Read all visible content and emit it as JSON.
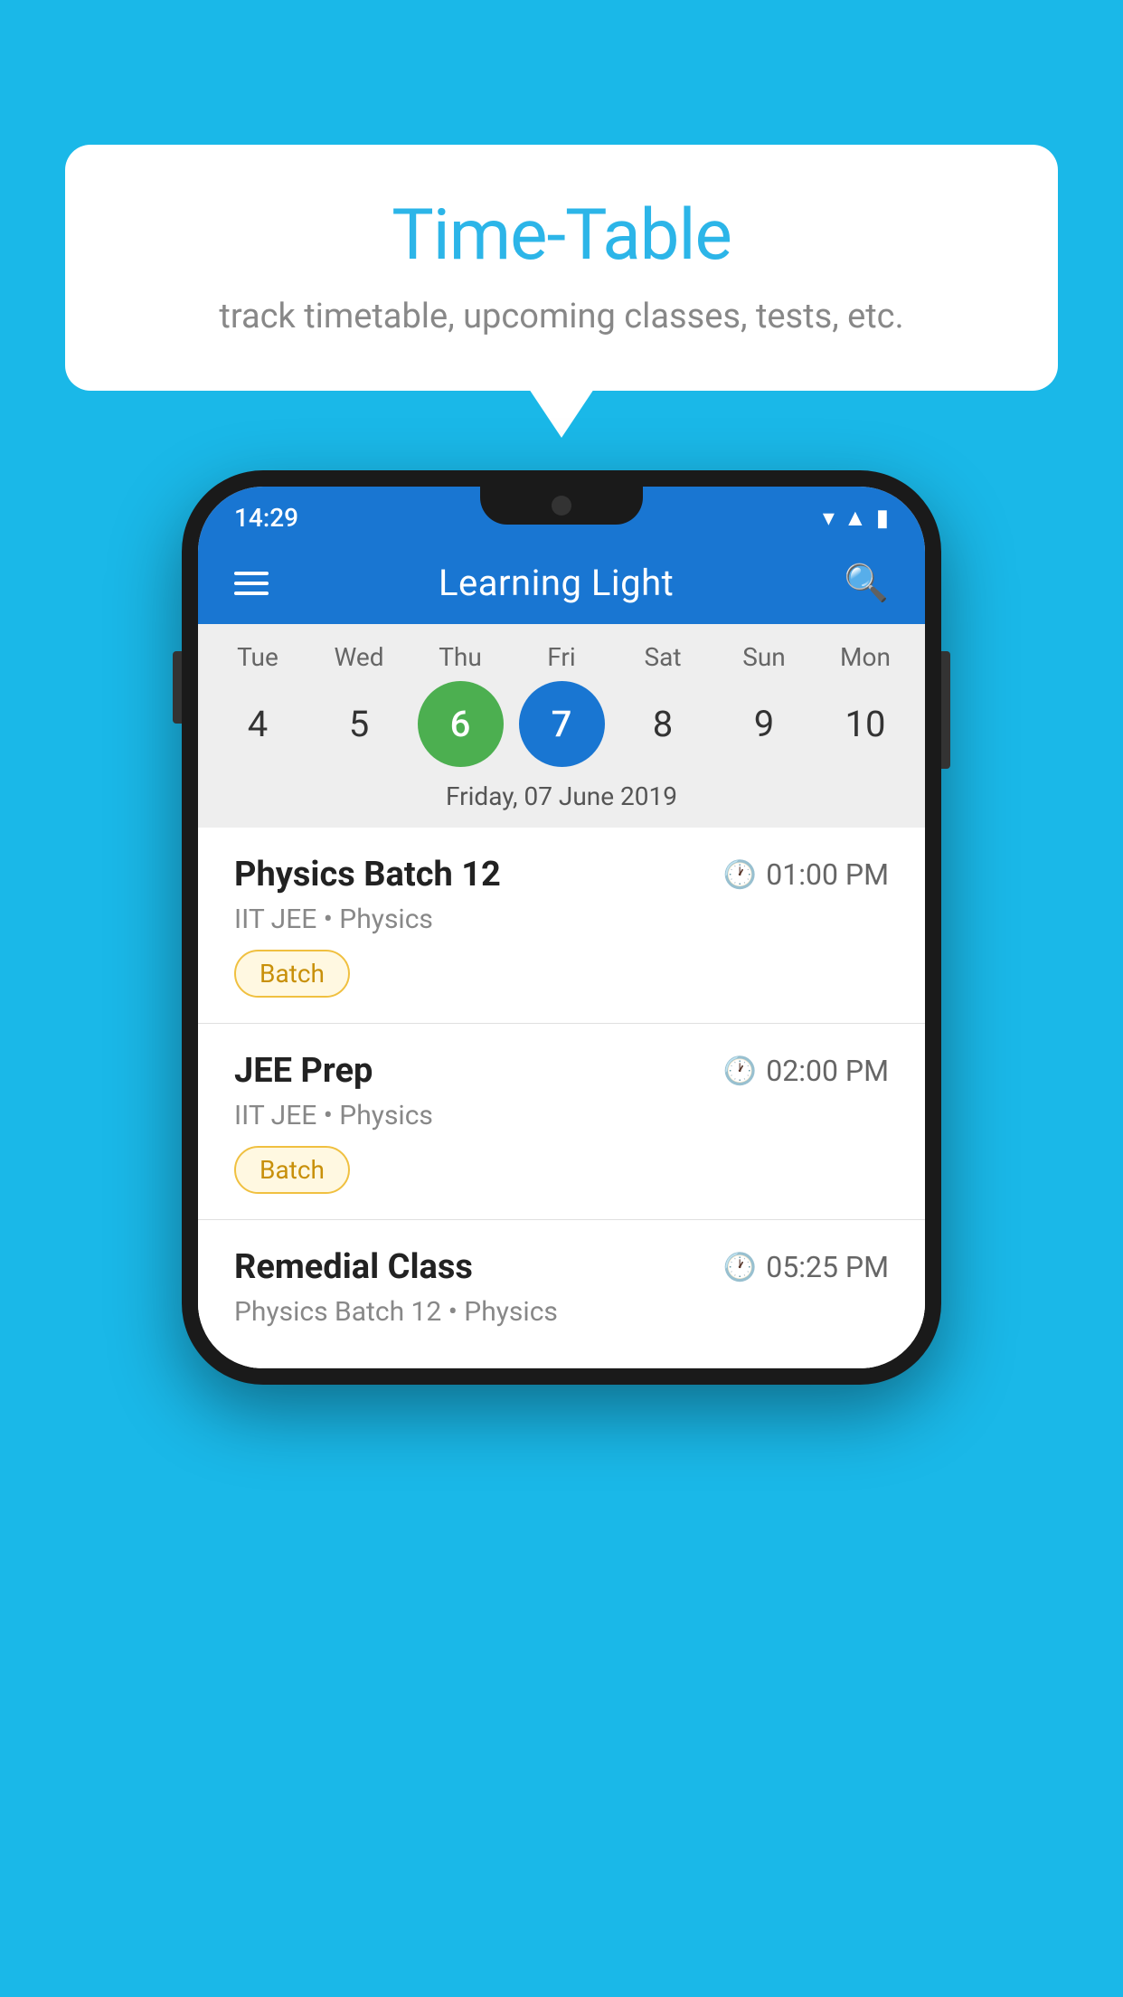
{
  "background": {
    "color": "#1ab8e8"
  },
  "speech_bubble": {
    "title": "Time-Table",
    "subtitle": "track timetable, upcoming classes, tests, etc."
  },
  "phone": {
    "status_bar": {
      "time": "14:29",
      "icons": [
        "wifi",
        "signal",
        "battery"
      ]
    },
    "app_bar": {
      "title": "Learning Light",
      "menu_label": "menu",
      "search_label": "search"
    },
    "calendar": {
      "days": [
        {
          "label": "Tue",
          "number": "4"
        },
        {
          "label": "Wed",
          "number": "5"
        },
        {
          "label": "Thu",
          "number": "6",
          "state": "today"
        },
        {
          "label": "Fri",
          "number": "7",
          "state": "selected"
        },
        {
          "label": "Sat",
          "number": "8"
        },
        {
          "label": "Sun",
          "number": "9"
        },
        {
          "label": "Mon",
          "number": "10"
        }
      ],
      "selected_date": "Friday, 07 June 2019"
    },
    "schedule": [
      {
        "title": "Physics Batch 12",
        "time": "01:00 PM",
        "subtitle": "IIT JEE • Physics",
        "badge": "Batch"
      },
      {
        "title": "JEE Prep",
        "time": "02:00 PM",
        "subtitle": "IIT JEE • Physics",
        "badge": "Batch"
      },
      {
        "title": "Remedial Class",
        "time": "05:25 PM",
        "subtitle": "Physics Batch 12 • Physics",
        "badge": null
      }
    ]
  }
}
